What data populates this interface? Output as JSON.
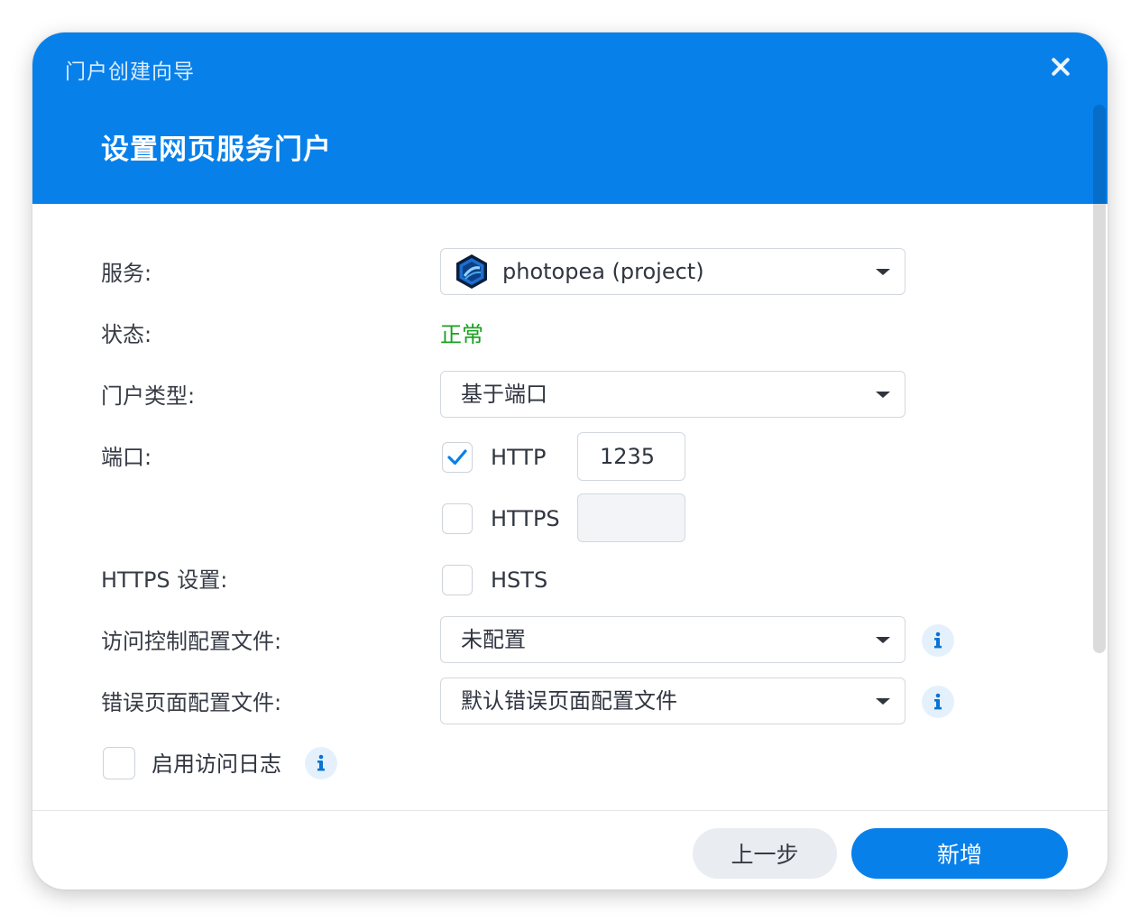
{
  "window": {
    "title": "门户创建向导",
    "page_title": "设置网页服务门户"
  },
  "colors": {
    "accent": "#0880ea",
    "status_ok": "#17a11d",
    "secondary_button": "#e9edf1"
  },
  "form": {
    "service": {
      "label": "服务:",
      "value": "photopea (project)",
      "icon": "photopea-app-icon"
    },
    "status": {
      "label": "状态:",
      "value": "正常"
    },
    "portal_type": {
      "label": "门户类型:",
      "value": "基于端口"
    },
    "port": {
      "label": "端口:",
      "http": {
        "label": "HTTP",
        "checked": true,
        "value": "1235"
      },
      "https": {
        "label": "HTTPS",
        "checked": false,
        "value": ""
      }
    },
    "https_settings": {
      "label": "HTTPS 设置:",
      "hsts": {
        "label": "HSTS",
        "checked": false
      }
    },
    "access_control": {
      "label": "访问控制配置文件:",
      "value": "未配置"
    },
    "error_page": {
      "label": "错误页面配置文件:",
      "value": "默认错误页面配置文件"
    },
    "access_log": {
      "label": "启用访问日志",
      "checked": false
    }
  },
  "footer": {
    "back_label": "上一步",
    "add_label": "新增"
  }
}
